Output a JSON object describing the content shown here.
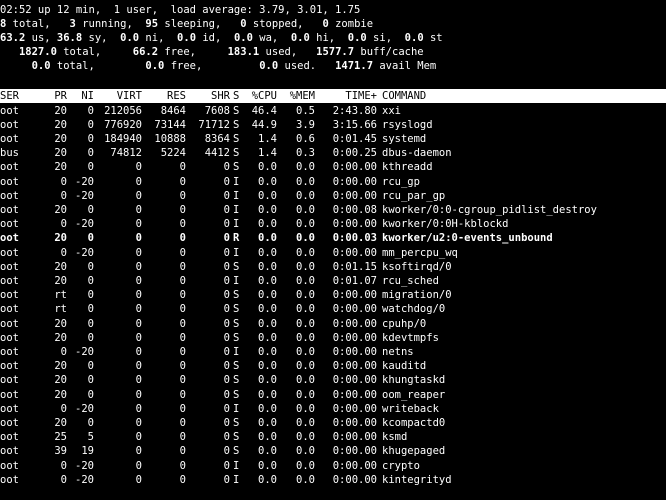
{
  "summary": {
    "uptime_line": "02:52 up 12 min,  1 user,  load average: 3.79, 3.01, 1.75",
    "tasks_line": {
      "total": "8",
      "total_label": " total,   ",
      "running": "3",
      "running_label": " running,  ",
      "sleeping": "95",
      "sleeping_label": " sleeping,   ",
      "stopped": "0",
      "stopped_label": " stopped,   ",
      "zombie": "0",
      "zombie_label": " zombie"
    },
    "cpu_line": {
      "us": "63.2",
      "us_label": " us, ",
      "sy": "36.8",
      "sy_label": " sy,  ",
      "ni": "0.0",
      "ni_label": " ni,  ",
      "id": "0.0",
      "id_label": " id,  ",
      "wa": "0.0",
      "wa_label": " wa,  ",
      "hi": "0.0",
      "hi_label": " hi,  ",
      "si": "0.0",
      "si_label": " si,  ",
      "st": "0.0",
      "st_label": " st"
    },
    "mem_line": {
      "total": "   1827.0",
      "total_label": " total,   ",
      "free": "  66.2",
      "free_label": " free,   ",
      "used": "  183.1",
      "used_label": " used,  ",
      "buff": " 1577.7",
      "buff_label": " buff/cache"
    },
    "swap_line": {
      "total": "     0.0",
      "total_label": " total,   ",
      "free": "     0.0",
      "free_label": " free,   ",
      "used": "      0.0",
      "used_label": " used.  ",
      "avail": " 1471.7",
      "avail_label": " avail Mem"
    }
  },
  "table": {
    "headers": {
      "user": "SER",
      "pr": "PR",
      "ni": "NI",
      "virt": "VIRT",
      "res": "RES",
      "shr": "SHR",
      "s": "S",
      "cpu": "%CPU",
      "mem": "%MEM",
      "time": "TIME+",
      "cmd": "COMMAND"
    },
    "rows": [
      {
        "user": "oot",
        "pr": "20",
        "ni": "0",
        "virt": "212056",
        "res": "8464",
        "shr": "7608",
        "s": "S",
        "cpu": "46.4",
        "mem": "0.5",
        "time": "2:43.80",
        "cmd": "xxi",
        "bold": false
      },
      {
        "user": "oot",
        "pr": "20",
        "ni": "0",
        "virt": "776920",
        "res": "73144",
        "shr": "71712",
        "s": "S",
        "cpu": "44.9",
        "mem": "3.9",
        "time": "3:15.66",
        "cmd": "rsyslogd",
        "bold": false
      },
      {
        "user": "oot",
        "pr": "20",
        "ni": "0",
        "virt": "184940",
        "res": "10888",
        "shr": "8364",
        "s": "S",
        "cpu": "1.4",
        "mem": "0.6",
        "time": "0:01.45",
        "cmd": "systemd",
        "bold": false
      },
      {
        "user": "bus",
        "pr": "20",
        "ni": "0",
        "virt": "74812",
        "res": "5224",
        "shr": "4412",
        "s": "S",
        "cpu": "1.4",
        "mem": "0.3",
        "time": "0:00.25",
        "cmd": "dbus-daemon",
        "bold": false
      },
      {
        "user": "oot",
        "pr": "20",
        "ni": "0",
        "virt": "0",
        "res": "0",
        "shr": "0",
        "s": "S",
        "cpu": "0.0",
        "mem": "0.0",
        "time": "0:00.00",
        "cmd": "kthreadd",
        "bold": false
      },
      {
        "user": "oot",
        "pr": "0",
        "ni": "-20",
        "virt": "0",
        "res": "0",
        "shr": "0",
        "s": "I",
        "cpu": "0.0",
        "mem": "0.0",
        "time": "0:00.00",
        "cmd": "rcu_gp",
        "bold": false
      },
      {
        "user": "oot",
        "pr": "0",
        "ni": "-20",
        "virt": "0",
        "res": "0",
        "shr": "0",
        "s": "I",
        "cpu": "0.0",
        "mem": "0.0",
        "time": "0:00.00",
        "cmd": "rcu_par_gp",
        "bold": false
      },
      {
        "user": "oot",
        "pr": "20",
        "ni": "0",
        "virt": "0",
        "res": "0",
        "shr": "0",
        "s": "I",
        "cpu": "0.0",
        "mem": "0.0",
        "time": "0:00.08",
        "cmd": "kworker/0:0-cgroup_pidlist_destroy",
        "bold": false
      },
      {
        "user": "oot",
        "pr": "0",
        "ni": "-20",
        "virt": "0",
        "res": "0",
        "shr": "0",
        "s": "I",
        "cpu": "0.0",
        "mem": "0.0",
        "time": "0:00.00",
        "cmd": "kworker/0:0H-kblockd",
        "bold": false
      },
      {
        "user": "oot",
        "pr": "20",
        "ni": "0",
        "virt": "0",
        "res": "0",
        "shr": "0",
        "s": "R",
        "cpu": "0.0",
        "mem": "0.0",
        "time": "0:00.03",
        "cmd": "kworker/u2:0-events_unbound",
        "bold": true
      },
      {
        "user": "oot",
        "pr": "0",
        "ni": "-20",
        "virt": "0",
        "res": "0",
        "shr": "0",
        "s": "I",
        "cpu": "0.0",
        "mem": "0.0",
        "time": "0:00.00",
        "cmd": "mm_percpu_wq",
        "bold": false
      },
      {
        "user": "oot",
        "pr": "20",
        "ni": "0",
        "virt": "0",
        "res": "0",
        "shr": "0",
        "s": "S",
        "cpu": "0.0",
        "mem": "0.0",
        "time": "0:01.15",
        "cmd": "ksoftirqd/0",
        "bold": false
      },
      {
        "user": "oot",
        "pr": "20",
        "ni": "0",
        "virt": "0",
        "res": "0",
        "shr": "0",
        "s": "I",
        "cpu": "0.0",
        "mem": "0.0",
        "time": "0:01.07",
        "cmd": "rcu_sched",
        "bold": false
      },
      {
        "user": "oot",
        "pr": "rt",
        "ni": "0",
        "virt": "0",
        "res": "0",
        "shr": "0",
        "s": "S",
        "cpu": "0.0",
        "mem": "0.0",
        "time": "0:00.00",
        "cmd": "migration/0",
        "bold": false
      },
      {
        "user": "oot",
        "pr": "rt",
        "ni": "0",
        "virt": "0",
        "res": "0",
        "shr": "0",
        "s": "S",
        "cpu": "0.0",
        "mem": "0.0",
        "time": "0:00.00",
        "cmd": "watchdog/0",
        "bold": false
      },
      {
        "user": "oot",
        "pr": "20",
        "ni": "0",
        "virt": "0",
        "res": "0",
        "shr": "0",
        "s": "S",
        "cpu": "0.0",
        "mem": "0.0",
        "time": "0:00.00",
        "cmd": "cpuhp/0",
        "bold": false
      },
      {
        "user": "oot",
        "pr": "20",
        "ni": "0",
        "virt": "0",
        "res": "0",
        "shr": "0",
        "s": "S",
        "cpu": "0.0",
        "mem": "0.0",
        "time": "0:00.00",
        "cmd": "kdevtmpfs",
        "bold": false
      },
      {
        "user": "oot",
        "pr": "0",
        "ni": "-20",
        "virt": "0",
        "res": "0",
        "shr": "0",
        "s": "I",
        "cpu": "0.0",
        "mem": "0.0",
        "time": "0:00.00",
        "cmd": "netns",
        "bold": false
      },
      {
        "user": "oot",
        "pr": "20",
        "ni": "0",
        "virt": "0",
        "res": "0",
        "shr": "0",
        "s": "S",
        "cpu": "0.0",
        "mem": "0.0",
        "time": "0:00.00",
        "cmd": "kauditd",
        "bold": false
      },
      {
        "user": "oot",
        "pr": "20",
        "ni": "0",
        "virt": "0",
        "res": "0",
        "shr": "0",
        "s": "S",
        "cpu": "0.0",
        "mem": "0.0",
        "time": "0:00.00",
        "cmd": "khungtaskd",
        "bold": false
      },
      {
        "user": "oot",
        "pr": "20",
        "ni": "0",
        "virt": "0",
        "res": "0",
        "shr": "0",
        "s": "S",
        "cpu": "0.0",
        "mem": "0.0",
        "time": "0:00.00",
        "cmd": "oom_reaper",
        "bold": false
      },
      {
        "user": "oot",
        "pr": "0",
        "ni": "-20",
        "virt": "0",
        "res": "0",
        "shr": "0",
        "s": "I",
        "cpu": "0.0",
        "mem": "0.0",
        "time": "0:00.00",
        "cmd": "writeback",
        "bold": false
      },
      {
        "user": "oot",
        "pr": "20",
        "ni": "0",
        "virt": "0",
        "res": "0",
        "shr": "0",
        "s": "S",
        "cpu": "0.0",
        "mem": "0.0",
        "time": "0:00.00",
        "cmd": "kcompactd0",
        "bold": false
      },
      {
        "user": "oot",
        "pr": "25",
        "ni": "5",
        "virt": "0",
        "res": "0",
        "shr": "0",
        "s": "S",
        "cpu": "0.0",
        "mem": "0.0",
        "time": "0:00.00",
        "cmd": "ksmd",
        "bold": false
      },
      {
        "user": "oot",
        "pr": "39",
        "ni": "19",
        "virt": "0",
        "res": "0",
        "shr": "0",
        "s": "S",
        "cpu": "0.0",
        "mem": "0.0",
        "time": "0:00.00",
        "cmd": "khugepaged",
        "bold": false
      },
      {
        "user": "oot",
        "pr": "0",
        "ni": "-20",
        "virt": "0",
        "res": "0",
        "shr": "0",
        "s": "I",
        "cpu": "0.0",
        "mem": "0.0",
        "time": "0:00.00",
        "cmd": "crypto",
        "bold": false
      },
      {
        "user": "oot",
        "pr": "0",
        "ni": "-20",
        "virt": "0",
        "res": "0",
        "shr": "0",
        "s": "I",
        "cpu": "0.0",
        "mem": "0.0",
        "time": "0:00.00",
        "cmd": "kintegrityd",
        "bold": false
      }
    ]
  }
}
